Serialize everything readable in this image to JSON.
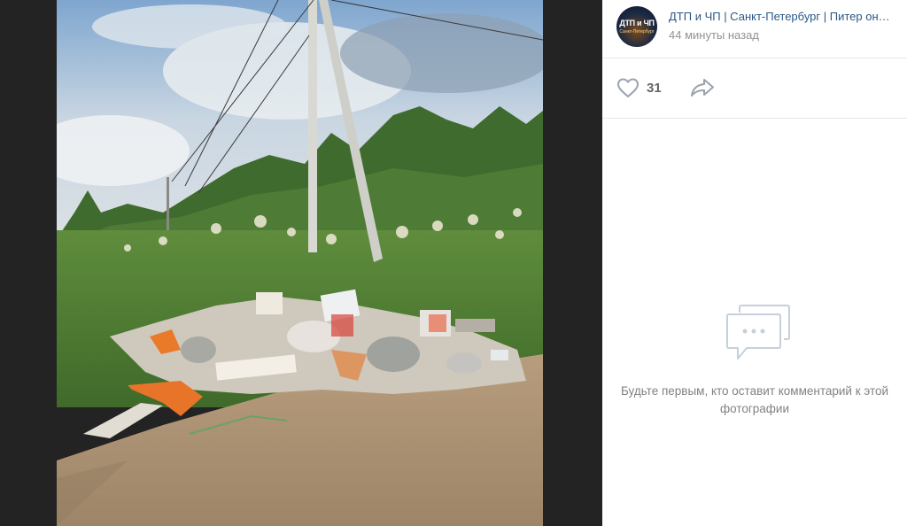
{
  "post": {
    "group_name": "ДТП и ЧП | Санкт-Петербург | Питер онлайн | СПб",
    "time": "44 минуты назад",
    "avatar": {
      "line1": "ДТП и ЧП",
      "line2": "Санкт-Петербург"
    }
  },
  "actions": {
    "likes_count": "31",
    "like_icon": "heart-icon",
    "share_icon": "share-icon"
  },
  "comments": {
    "empty_icon": "comment-bubble-icon",
    "empty_text": "Будьте первым, кто оставит комментарий к этой фотографии"
  },
  "colors": {
    "link": "#2a5885",
    "muted": "#939393",
    "icon": "#99a2ad",
    "viewer_bg": "#232323"
  }
}
